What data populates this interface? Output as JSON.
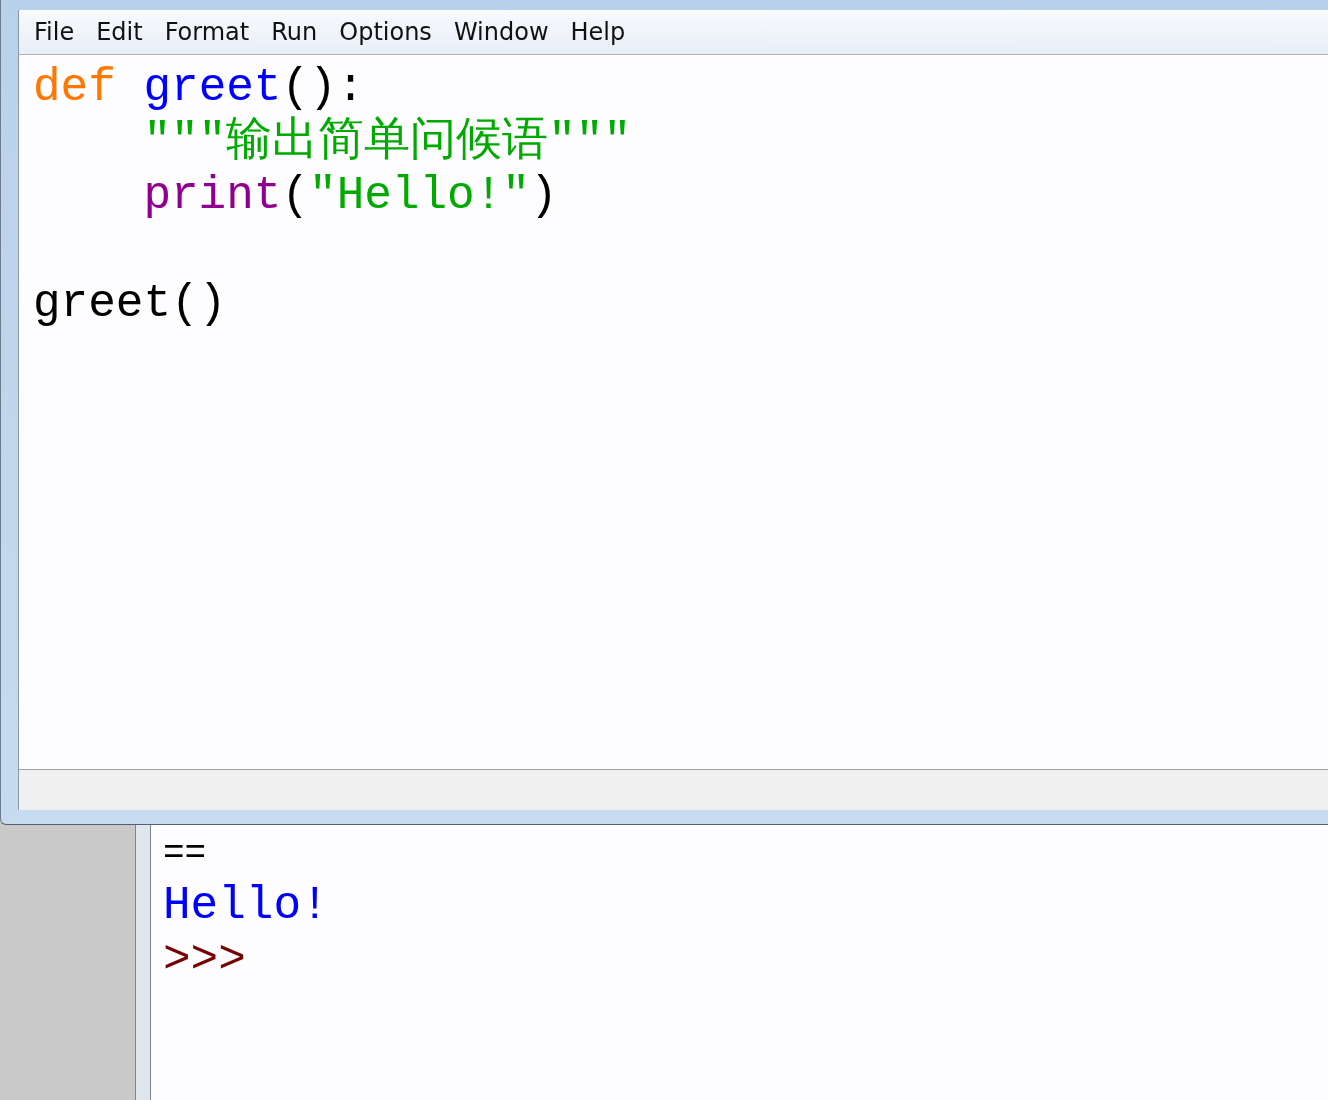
{
  "editor": {
    "menu": [
      {
        "label": "File"
      },
      {
        "label": "Edit"
      },
      {
        "label": "Format"
      },
      {
        "label": "Run"
      },
      {
        "label": "Options"
      },
      {
        "label": "Window"
      },
      {
        "label": "Help"
      }
    ],
    "lines": [
      {
        "kind": "code",
        "indented": false,
        "tokens": [
          {
            "kind": "keyword",
            "text": "def"
          },
          {
            "kind": "definition",
            "text": "greet",
            "space_before": true
          },
          {
            "kind": "plain",
            "text": "():"
          }
        ]
      },
      {
        "kind": "code",
        "indented": true,
        "tokens": [
          {
            "kind": "string",
            "text": "\"\"\"输出简单问候语\"\"\""
          }
        ]
      },
      {
        "kind": "code",
        "indented": true,
        "tokens": [
          {
            "kind": "builtin",
            "text": "print"
          },
          {
            "kind": "plain",
            "text": "("
          },
          {
            "kind": "string",
            "text": "\"Hello!\""
          },
          {
            "kind": "plain",
            "text": ")"
          }
        ]
      },
      {
        "kind": "blank"
      },
      {
        "kind": "code",
        "indented": false,
        "tokens": [
          {
            "kind": "plain",
            "text": "greet()"
          }
        ]
      }
    ]
  },
  "shell": {
    "lines": [
      {
        "kind": "plain",
        "text": "=="
      },
      {
        "kind": "output",
        "text": "Hello!"
      },
      {
        "kind": "prompt",
        "text": ">>>"
      }
    ]
  }
}
